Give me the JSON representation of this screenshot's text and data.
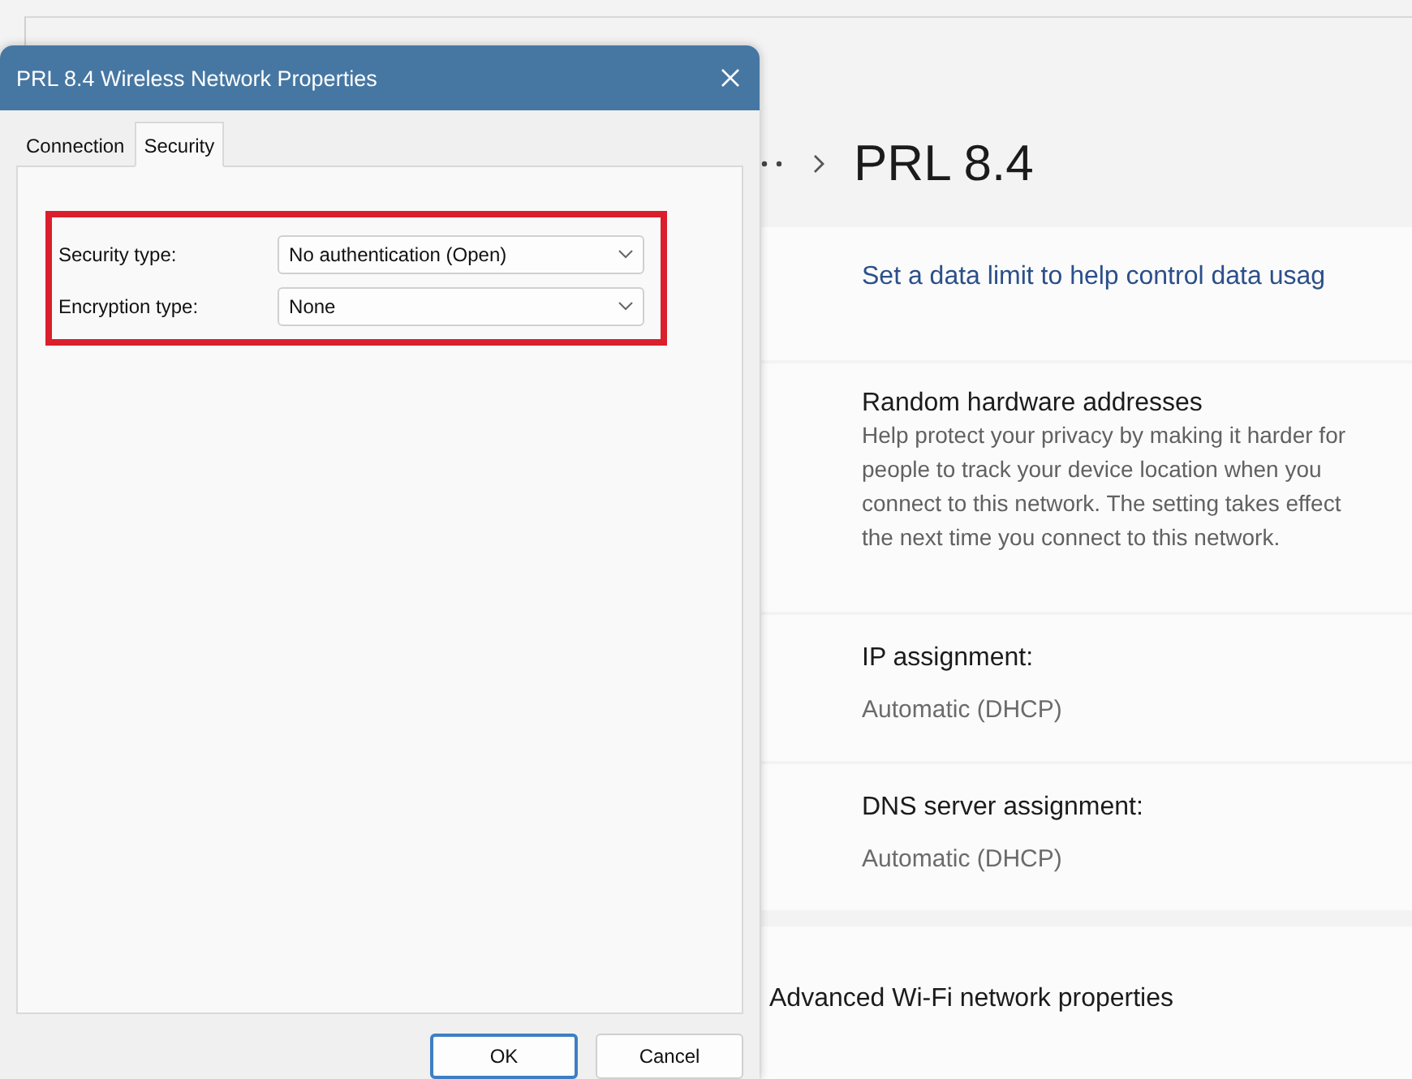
{
  "settings": {
    "title": "PRL 8.4",
    "rows": [
      {
        "kind": "link",
        "text": "Set a data limit to help control data usag"
      },
      {
        "kind": "info",
        "title": "Random hardware addresses",
        "description": "Help protect your privacy by making it harder for people to track your device location when you connect to this network. The setting takes effect the next time you connect to this network."
      },
      {
        "kind": "value",
        "title": "IP assignment:",
        "value": "Automatic (DHCP)"
      },
      {
        "kind": "value",
        "title": "DNS server assignment:",
        "value": "Automatic (DHCP)"
      },
      {
        "kind": "nav",
        "title": "Advanced Wi-Fi network properties"
      }
    ]
  },
  "dialog": {
    "title": "PRL 8.4 Wireless Network Properties",
    "tabs": [
      {
        "label": "Connection",
        "selected": false
      },
      {
        "label": "Security",
        "selected": true
      }
    ],
    "fields": [
      {
        "label": "Security type:",
        "value": "No authentication (Open)"
      },
      {
        "label": "Encryption type:",
        "value": "None"
      }
    ],
    "buttons": [
      {
        "label": "OK",
        "default": true
      },
      {
        "label": "Cancel",
        "default": false
      }
    ]
  }
}
